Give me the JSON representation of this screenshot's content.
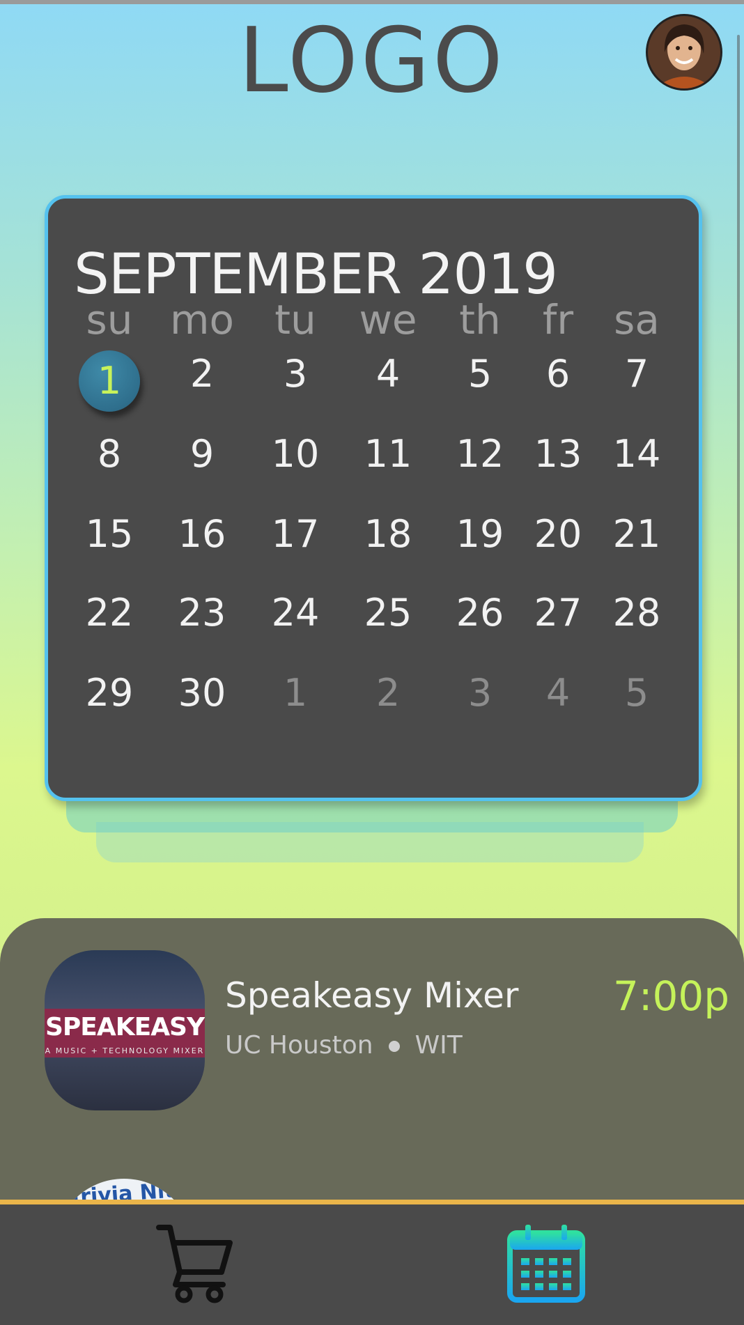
{
  "header": {
    "logo_text": "LOGO",
    "avatar_icon": "user-avatar"
  },
  "calendar": {
    "title": "SEPTEMBER 2019",
    "weekdays": [
      "su",
      "mo",
      "tu",
      "we",
      "th",
      "fr",
      "sa"
    ],
    "weeks": [
      [
        "1",
        "2",
        "3",
        "4",
        "5",
        "6",
        "7"
      ],
      [
        "8",
        "9",
        "10",
        "11",
        "12",
        "13",
        "14"
      ],
      [
        "15",
        "16",
        "17",
        "18",
        "19",
        "20",
        "21"
      ],
      [
        "22",
        "23",
        "24",
        "25",
        "26",
        "27",
        "28"
      ],
      [
        "29",
        "30",
        "1",
        "2",
        "3",
        "4",
        "5"
      ]
    ],
    "selected_day": "1",
    "accent_color": "#55c2ee",
    "selected_text_color": "#c8f25a"
  },
  "events": [
    {
      "title": "Speakeasy Mixer",
      "time": "7:00p",
      "location": "UC Houston",
      "organizer": "WIT",
      "thumb_title": "SPEAKEASY",
      "thumb_subtitle": "A MUSIC + TECHNOLOGY MIXER"
    },
    {
      "thumb_title": "Trivia Nite"
    }
  ],
  "tabbar": {
    "border_color": "#eab54a",
    "items": [
      {
        "icon": "cart-icon"
      },
      {
        "icon": "calendar-icon",
        "active": true
      }
    ]
  }
}
